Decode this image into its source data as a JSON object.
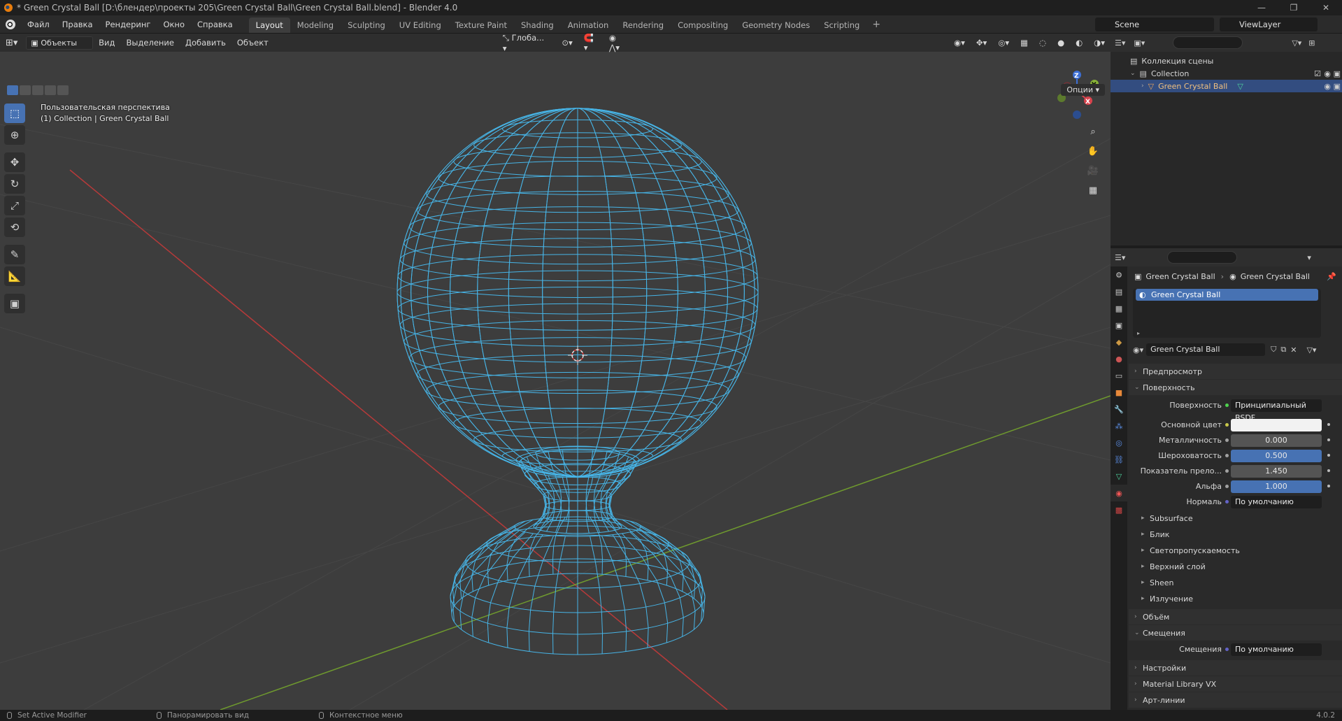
{
  "window": {
    "title": "* Green Crystal Ball [D:\\блендер\\проекты 205\\Green Crystal Ball\\Green Crystal Ball.blend] - Blender 4.0",
    "controls": [
      "—",
      "❐",
      "✕"
    ]
  },
  "menubar": {
    "menus": [
      "Файл",
      "Правка",
      "Рендеринг",
      "Окно",
      "Справка"
    ],
    "workspaces": [
      "Layout",
      "Modeling",
      "Sculpting",
      "UV Editing",
      "Texture Paint",
      "Shading",
      "Animation",
      "Rendering",
      "Compositing",
      "Geometry Nodes",
      "Scripting"
    ],
    "active_workspace": "Layout",
    "add_tab": "+",
    "scene": "Scene",
    "view_layer": "ViewLayer"
  },
  "viewport": {
    "header": {
      "mode": "Объекты",
      "menus": [
        "Вид",
        "Выделение",
        "Добавить",
        "Объект"
      ],
      "orientation": "Глоба...",
      "options": "Опции"
    },
    "overlay": {
      "view_name": "Пользовательская перспектива",
      "context": "(1) Collection | Green Crystal Ball"
    },
    "tools": [
      "select-box",
      "cursor",
      "move",
      "rotate",
      "scale",
      "transform",
      "annotate",
      "measure",
      "add-cube"
    ],
    "gizmo_axes": [
      "Z",
      "Y",
      "X"
    ]
  },
  "outliner": {
    "scene_collection": "Коллекция сцены",
    "collection": "Collection",
    "object": "Green Crystal Ball"
  },
  "properties": {
    "breadcrumb_object": "Green Crystal Ball",
    "breadcrumb_material": "Green Crystal Ball",
    "slot_name": "Green Crystal Ball",
    "material_name": "Green Crystal Ball",
    "sections": {
      "preview": "Предпросмотр",
      "surface": "Поверхность",
      "volume": "Объём",
      "displacement": "Смещения",
      "settings": "Настройки",
      "material_library": "Material Library VX",
      "line_art": "Арт-линии"
    },
    "surface_label": "Поверхность",
    "surface_value": "Принципиальный BSDF",
    "fields": [
      {
        "label": "Основной цвет",
        "value": "",
        "color": "#f2f2f2",
        "dot": "#c8c84a"
      },
      {
        "label": "Металличность",
        "value": "0.000",
        "fill": 0.0,
        "dot": "#a1a1a1"
      },
      {
        "label": "Шероховатость",
        "value": "0.500",
        "fill": 1.0,
        "dot": "#a1a1a1"
      },
      {
        "label": "Показатель прело...",
        "value": "1.450",
        "fill": 0.0,
        "dot": "#a1a1a1"
      },
      {
        "label": "Альфа",
        "value": "1.000",
        "fill": 1.0,
        "dot": "#a1a1a1"
      },
      {
        "label": "Нормаль",
        "value": "По умолчанию",
        "dot": "#6363c7"
      }
    ],
    "subpanels": [
      "Subsurface",
      "Блик",
      "Светопропускаемость",
      "Верхний слой",
      "Sheen",
      "Излучение"
    ],
    "displacement_label": "Смещения",
    "displacement_value": "По умолчанию"
  },
  "statusbar": {
    "hint1": "Set Active Modifier",
    "hint2": "Панорамировать вид",
    "hint3": "Контекстное меню",
    "version": "4.0.2"
  },
  "colors": {
    "accent": "#4772b3",
    "wire": "#47b4e6",
    "axis_x": "#b83a3a",
    "axis_y": "#6f9a2e"
  }
}
